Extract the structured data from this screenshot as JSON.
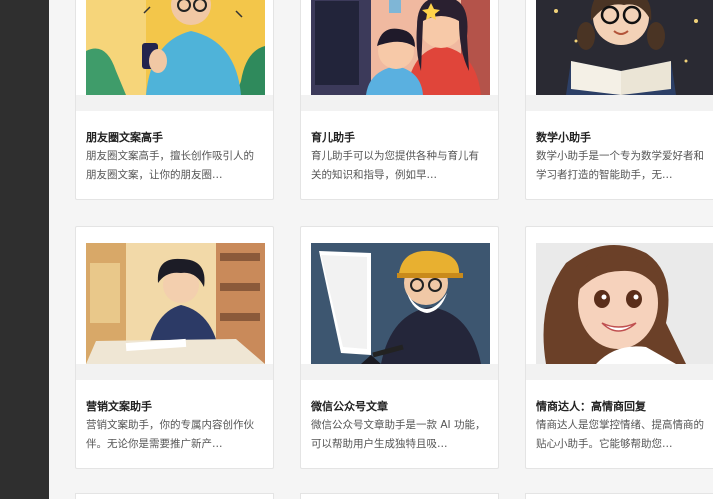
{
  "cards": [
    {
      "title": "朋友圈文案高手",
      "desc": "朋友圈文案高手，擅长创作吸引人的朋友圈文案，让你的朋友圈…",
      "illustration": "boy-with-phone-illustration"
    },
    {
      "title": "育儿助手",
      "desc": "育儿助手可以为您提供各种与育儿有关的知识和指导，例如早…",
      "illustration": "mother-child-computer-illustration"
    },
    {
      "title": "数学小助手",
      "desc": "数学小助手是一个专为数学爱好者和学习者打造的智能助手，无…",
      "illustration": "girl-reading-book-illustration"
    },
    {
      "title": "营销文案助手",
      "desc": "营销文案助手，你的专属内容创作伙伴。无论你是需要推广新产…",
      "illustration": "boy-writing-desk-illustration"
    },
    {
      "title": "微信公众号文章",
      "desc": "微信公众号文章助手是一款 AI 功能，可以帮助用户生成独特且吸…",
      "illustration": "old-man-computer-illustration"
    },
    {
      "title": "情商达人：高情商回复",
      "desc": "情商达人是您掌控情绪、提高情商的贴心小助手。它能够帮助您…",
      "illustration": "smiling-woman-illustration"
    }
  ]
}
